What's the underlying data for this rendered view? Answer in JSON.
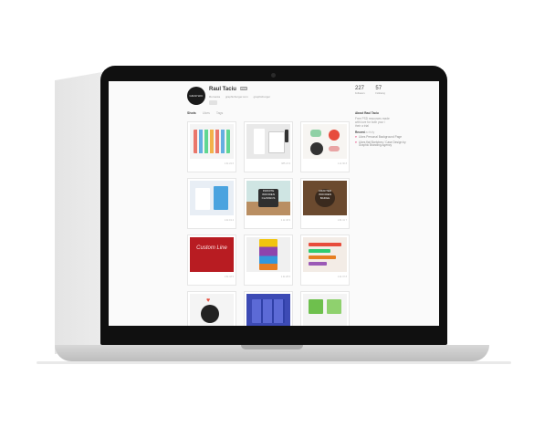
{
  "profile": {
    "avatar_text": "GRAPHIC BURGER",
    "name": "Raul Taciu",
    "badge": "PRO",
    "location": "Romania",
    "website": "graphicburger.com",
    "twitter": "graphicburger"
  },
  "stats": [
    {
      "value": "227",
      "label": "Followers"
    },
    {
      "value": "57",
      "label": "Following"
    }
  ],
  "tabs": [
    "Shots",
    "Likes",
    "Tags"
  ],
  "sidebar": {
    "about_heading": "About Raul Taciu",
    "bio": "Free PSD resources made with love for both your / their a trial",
    "recent_heading": "Recent",
    "recent_link": "activity",
    "recent_items": [
      "Likes Personal Background Page",
      "Likes flat Sketches / Case Design by Graphic Branding Agency"
    ]
  },
  "shots": [
    {
      "theme": "icons",
      "stats": "1.3k  24  6"
    },
    {
      "theme": "stationery",
      "stats": "985  21  9"
    },
    {
      "theme": "retro-ui",
      "stats": "1.1k  30  8"
    },
    {
      "theme": "mockups",
      "stats": "1.0k  19  4"
    },
    {
      "theme": "wooden-classics",
      "sign": "INFINITE WOODEN CLASSICS",
      "stats": "2.1k  46  9"
    },
    {
      "theme": "wooden-badge",
      "sign": "CRAFTED WOODEN BADGE",
      "stats": "1.8k  41  7"
    },
    {
      "theme": "custom-line",
      "sign": "Custom Line",
      "stats": "1.5k  33  5"
    },
    {
      "theme": "phone-ui",
      "stats": "1.2k  28  6"
    },
    {
      "theme": "ui-kit",
      "stats": "1.4k  37  8"
    },
    {
      "theme": "love",
      "stats": ""
    },
    {
      "theme": "blue-ui",
      "stats": ""
    },
    {
      "theme": "green-ui",
      "stats": ""
    }
  ],
  "colors": {
    "accent_pink": "#e5457b",
    "screen_bg": "#fafafa",
    "bezel": "#101010"
  }
}
